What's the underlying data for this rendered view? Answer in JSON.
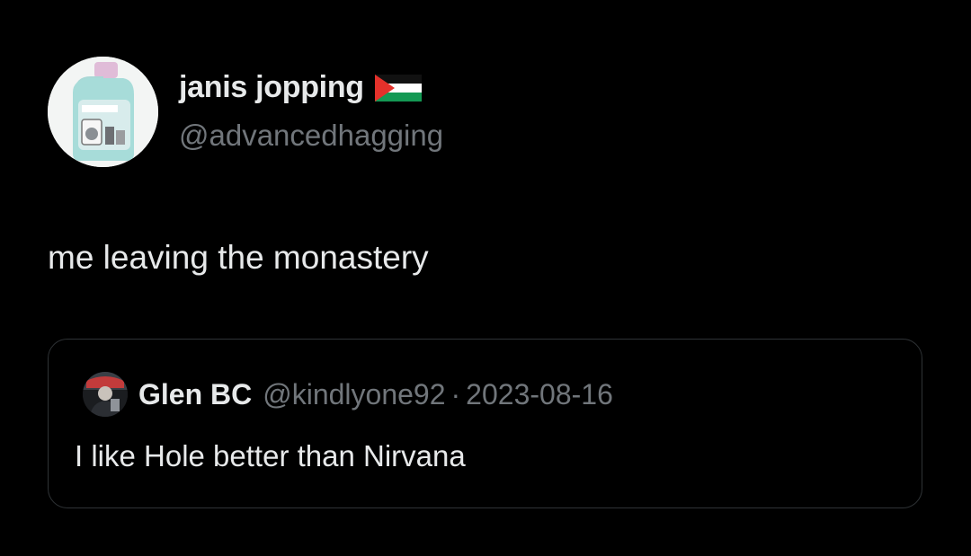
{
  "tweet": {
    "author": {
      "display_name": "janis jopping",
      "handle": "@advancedhagging",
      "flag_icon": "palestine-flag-icon",
      "avatar_icon": "detergent-bottle-avatar"
    },
    "text": "me leaving the monastery"
  },
  "quote": {
    "author": {
      "display_name": "Glen BC",
      "handle": "@kindlyone92",
      "separator": "·",
      "date": "2023-08-16",
      "avatar_icon": "user-photo-avatar"
    },
    "text": "I like Hole better than Nirvana"
  },
  "colors": {
    "background": "#000000",
    "primary_text": "#e7e9ea",
    "secondary_text": "#71767b",
    "border": "#2f3336"
  }
}
